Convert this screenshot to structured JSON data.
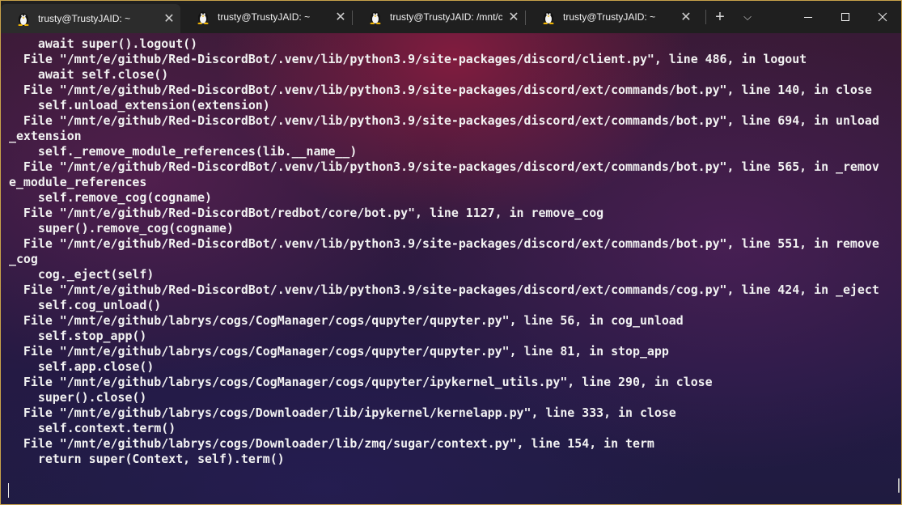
{
  "tabs": [
    {
      "title": "trusty@TrustyJAID: ~",
      "active": true,
      "close": "✕",
      "icon": "tux-icon"
    },
    {
      "title": "trusty@TrustyJAID: ~",
      "active": false,
      "close": "✕",
      "icon": "tux-icon"
    },
    {
      "title": "trusty@TrustyJAID: /mnt/c/",
      "active": false,
      "close": "✕",
      "icon": "tux-icon"
    },
    {
      "title": "trusty@TrustyJAID: ~",
      "active": false,
      "close": "✕",
      "icon": "tux-icon"
    }
  ],
  "toolbar": {
    "new_tab": "+",
    "dropdown": "⌵"
  },
  "window_controls": {
    "minimize": "minimize-icon",
    "maximize": "maximize-icon",
    "close": "close-icon"
  },
  "colors": {
    "tab_bar": "#1f1f1f",
    "active_tab": "#2c2c2c",
    "text": "#f2f2f2",
    "border": "#c8a24a"
  },
  "terminal": {
    "lines": [
      "    await super().logout()",
      "  File \"/mnt/e/github/Red-DiscordBot/.venv/lib/python3.9/site-packages/discord/client.py\", line 486, in logout",
      "    await self.close()",
      "  File \"/mnt/e/github/Red-DiscordBot/.venv/lib/python3.9/site-packages/discord/ext/commands/bot.py\", line 140, in close",
      "    self.unload_extension(extension)",
      "  File \"/mnt/e/github/Red-DiscordBot/.venv/lib/python3.9/site-packages/discord/ext/commands/bot.py\", line 694, in unload",
      "_extension",
      "    self._remove_module_references(lib.__name__)",
      "  File \"/mnt/e/github/Red-DiscordBot/.venv/lib/python3.9/site-packages/discord/ext/commands/bot.py\", line 565, in _remov",
      "e_module_references",
      "    self.remove_cog(cogname)",
      "  File \"/mnt/e/github/Red-DiscordBot/redbot/core/bot.py\", line 1127, in remove_cog",
      "    super().remove_cog(cogname)",
      "  File \"/mnt/e/github/Red-DiscordBot/.venv/lib/python3.9/site-packages/discord/ext/commands/bot.py\", line 551, in remove",
      "_cog",
      "    cog._eject(self)",
      "  File \"/mnt/e/github/Red-DiscordBot/.venv/lib/python3.9/site-packages/discord/ext/commands/cog.py\", line 424, in _eject",
      "    self.cog_unload()",
      "  File \"/mnt/e/github/labrys/cogs/CogManager/cogs/qupyter/qupyter.py\", line 56, in cog_unload",
      "    self.stop_app()",
      "  File \"/mnt/e/github/labrys/cogs/CogManager/cogs/qupyter/qupyter.py\", line 81, in stop_app",
      "    self.app.close()",
      "  File \"/mnt/e/github/labrys/cogs/CogManager/cogs/qupyter/ipykernel_utils.py\", line 290, in close",
      "    super().close()",
      "  File \"/mnt/e/github/labrys/cogs/Downloader/lib/ipykernel/kernelapp.py\", line 333, in close",
      "    self.context.term()",
      "  File \"/mnt/e/github/labrys/cogs/Downloader/lib/zmq/sugar/context.py\", line 154, in term",
      "    return super(Context, self).term()"
    ]
  }
}
